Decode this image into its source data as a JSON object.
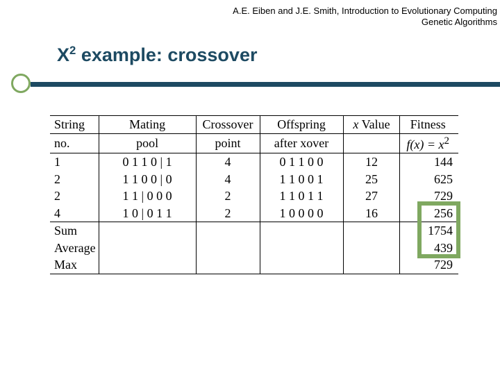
{
  "attribution": {
    "line1": "A.E. Eiben and J.E. Smith, Introduction to Evolutionary Computing",
    "line2": "Genetic Algorithms"
  },
  "title": {
    "prefix": "X",
    "sup": "2",
    "rest": " example: crossover"
  },
  "table": {
    "headers": {
      "c1a": "String",
      "c1b": "no.",
      "c2a": "Mating",
      "c2b": "pool",
      "c3a": "Crossover",
      "c3b": "point",
      "c4a": "Offspring",
      "c4b": "after xover",
      "c5a": "x",
      "c5b": "Value",
      "c6a": "Fitness",
      "c6b_pre": "f(x) = x",
      "c6b_sup": "2"
    },
    "rows": [
      {
        "no": "1",
        "pool": "0 1 1 0 | 1",
        "cp": "4",
        "off": "0 1 1 0 0",
        "x": "12",
        "fit": "144"
      },
      {
        "no": "2",
        "pool": "1 1 0 0 | 0",
        "cp": "4",
        "off": "1 1 0 0 1",
        "x": "25",
        "fit": "625"
      },
      {
        "no": "2",
        "pool": "1 1 | 0 0 0",
        "cp": "2",
        "off": "1 1 0 1 1",
        "x": "27",
        "fit": "729"
      },
      {
        "no": "4",
        "pool": "1 0 | 0 1 1",
        "cp": "2",
        "off": "1 0 0 0 0",
        "x": "16",
        "fit": "256"
      }
    ],
    "summary": [
      {
        "label": "Sum",
        "fit": "1754"
      },
      {
        "label": "Average",
        "fit": "439"
      },
      {
        "label": "Max",
        "fit": "729"
      }
    ]
  },
  "chart_data": {
    "type": "table",
    "title": "X^2 example: crossover",
    "columns": [
      "String no.",
      "Mating pool",
      "Crossover point",
      "Offspring after xover",
      "x Value",
      "Fitness f(x)=x^2"
    ],
    "rows": [
      [
        "1",
        "01101",
        4,
        "01100",
        12,
        144
      ],
      [
        "2",
        "11000",
        4,
        "11001",
        25,
        625
      ],
      [
        "2",
        "11000",
        2,
        "11011",
        27,
        729
      ],
      [
        "4",
        "10011",
        2,
        "10000",
        16,
        256
      ]
    ],
    "summary": {
      "Sum": 1754,
      "Average": 439,
      "Max": 729
    }
  }
}
